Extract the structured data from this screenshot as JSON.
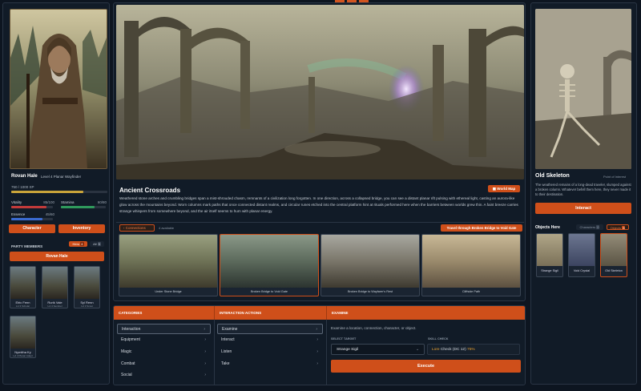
{
  "character": {
    "name": "Rovan Hale",
    "subtitle": "Level 4 Planar Wayfinder",
    "xp_text": "750 / 1000 XP",
    "xp_fraction": 0.75,
    "vitality_label": "Vitality",
    "vitality_value": "85/100",
    "vitality_fraction": 0.85,
    "stamina_label": "Stamina",
    "stamina_value": "60/80",
    "stamina_fraction": 0.75,
    "essence_label": "Essence",
    "essence_value": "45/60",
    "essence_fraction": 0.75,
    "character_btn": "Character",
    "inventory_btn": "Inventory"
  },
  "party": {
    "title": "PARTY MEMBERS",
    "hero_pill": "Hero",
    "hero_count": "4",
    "all_pill": "All",
    "all_count": "5",
    "leader_btn": "Rovan Hale",
    "members": [
      {
        "name": "Elric Fenn",
        "level": "Lvl 3 Scholar"
      },
      {
        "name": "Rurik Vale",
        "level": "Lvl 4 Sentinel"
      },
      {
        "name": "Syl Renn",
        "level": "Lvl 3 Scout"
      },
      {
        "name": "Nymitha Ky",
        "level": "Lvl 4 Planar Adept"
      }
    ]
  },
  "location": {
    "title": "Ancient Crossroads",
    "world_map_btn": "World Map",
    "description": "Weathered stone arches and crumbling bridges span a mist-shrouded chasm, remnants of a civilization long forgotten. In one direction, across a collapsed bridge, you can see a distant planar rift pulsing with ethereal light, casting an aurora-like glow across the mountains beyond. Worn columns mark paths that once connected distant realms, and circular runes etched into the central platform hint at rituals performed here when the barriers between worlds grew thin. A faint breeze carries strange whispers from somewhere beyond, and the air itself seems to hum with planar energy."
  },
  "connections": {
    "tab_label": "Connections",
    "count_text": "4 available",
    "travel_btn": "Travel through Broken Bridge to Void Gate",
    "items": [
      {
        "label": "Under Stone Bridge"
      },
      {
        "label": "Broken Bridge to Void Gate"
      },
      {
        "label": "Broken Bridge to Wayfarer's Rest"
      },
      {
        "label": "Cliffside Path"
      }
    ]
  },
  "target": {
    "name": "Old Skeleton",
    "tag": "Point of Interest",
    "description": "The weathered remains of a long-dead traveler, slumped against a broken column. Whatever befell them here, they never made it to their destination.",
    "interact_btn": "Interact"
  },
  "objects": {
    "title": "Objects Here",
    "characters_pill": "Characters",
    "characters_count": "0",
    "objects_pill": "Objects",
    "objects_count": "3",
    "items": [
      {
        "name": "Strange Sigil"
      },
      {
        "name": "Void Crystal"
      },
      {
        "name": "Old Skeleton"
      }
    ]
  },
  "actions": {
    "categories_header": "CATEGORIES",
    "actions_header": "INTERACTION ACTIONS",
    "examine_header": "EXAMINE",
    "categories": [
      "Interaction",
      "Equipment",
      "Magic",
      "Combat",
      "Social"
    ],
    "interaction_actions": [
      "Examine",
      "Interact",
      "Listen",
      "Take"
    ],
    "examine_desc": "Examine a location, connection, character, or object.",
    "select_target_label": "SELECT TARGET",
    "skill_check_label": "SKILL CHECK",
    "selected_target": "Strange Sigil",
    "skill_name": "Lore",
    "skill_check_text": "Check (DC 12)",
    "skill_chance": "75%",
    "execute_btn": "Execute"
  },
  "colors": {
    "accent": "#cf4f1a",
    "vitality": "#c23a3a",
    "stamina": "#2f9a5c",
    "essence": "#3a6ad0",
    "xp": "#c9a43a"
  }
}
